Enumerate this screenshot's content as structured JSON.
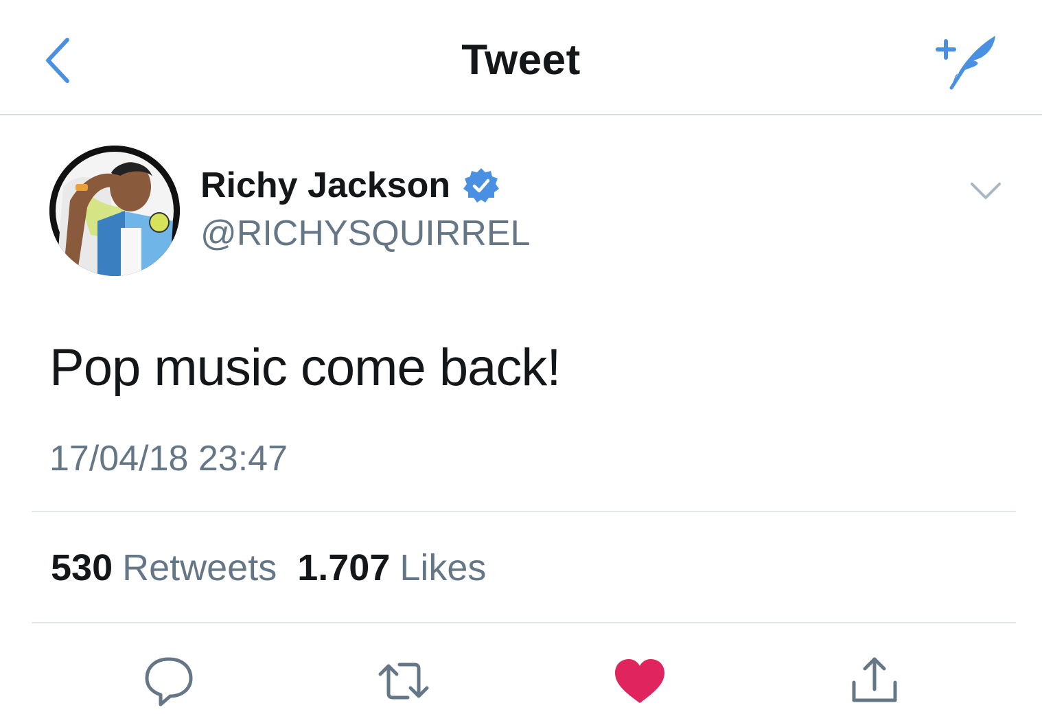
{
  "nav": {
    "title": "Tweet",
    "back_icon": "chevron-left-icon",
    "compose_icon": "compose-tweet-icon"
  },
  "author": {
    "name": "Richy Jackson",
    "handle": "@RICHYSQUIRREL",
    "verified": true,
    "avatar": "illustrated-portrait"
  },
  "tweet": {
    "text": "Pop music come back!",
    "timestamp": "17/04/18 23:47"
  },
  "stats": {
    "retweets_count": "530",
    "retweets_label": "Retweets",
    "likes_count": "1.707",
    "likes_label": "Likes"
  },
  "actions": {
    "reply": "reply-icon",
    "retweet": "retweet-icon",
    "like": "heart-icon",
    "share": "share-icon",
    "liked": true
  },
  "colors": {
    "accent": "#4a90e2",
    "text": "#14171a",
    "secondary": "#657786",
    "like": "#e0245e",
    "icon_gray": "#657786",
    "divider": "#e1e8ed"
  }
}
